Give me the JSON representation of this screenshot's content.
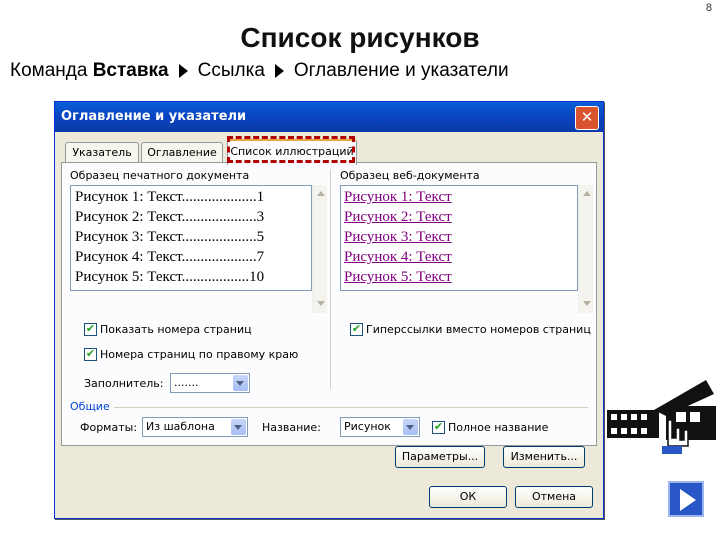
{
  "slide": {
    "number": "8",
    "title": "Список рисунков",
    "command_prefix": "Команда",
    "path": [
      "Вставка",
      "Ссылка",
      "Оглавление и указатели"
    ]
  },
  "dialog": {
    "title": "Оглавление и указатели",
    "close_symbol": "✕",
    "tabs": [
      "Указатель",
      "Оглавление",
      "Список иллюстраций"
    ],
    "print_preview_label": "Образец печатного документа",
    "print_preview_rows": [
      {
        "text": "Рисунок 1: Текст",
        "leader": "....................",
        "page": "1"
      },
      {
        "text": "Рисунок 2: Текст",
        "leader": "....................",
        "page": "3"
      },
      {
        "text": "Рисунок 3: Текст",
        "leader": "....................",
        "page": "5"
      },
      {
        "text": "Рисунок 4: Текст",
        "leader": "....................",
        "page": "7"
      },
      {
        "text": "Рисунок 5: Текст",
        "leader": "..................",
        "page": "10"
      }
    ],
    "web_preview_label": "Образец веб-документа",
    "web_preview_rows": [
      "Рисунок 1: Текст",
      "Рисунок 2: Текст",
      "Рисунок 3: Текст",
      "Рисунок 4: Текст",
      "Рисунок 5: Текст"
    ],
    "show_page_numbers": {
      "label": "Показать номера страниц",
      "checked": true
    },
    "right_align": {
      "label": "Номера страниц по правому краю",
      "checked": true
    },
    "hyperlinks": {
      "label": "Гиперссылки вместо номеров страниц",
      "checked": true
    },
    "filler_label": "Заполнитель:",
    "filler_value": ".......",
    "general_label": "Общие",
    "formats_label": "Форматы:",
    "formats_value": "Из шаблона",
    "caption_label": "Название:",
    "caption_value": "Рисунок",
    "full_caption": {
      "label": "Полное название",
      "checked": true
    },
    "options_button": "Параметры...",
    "modify_button": "Изменить...",
    "ok_button": "ОК",
    "cancel_button": "Отмена"
  },
  "colors": {
    "accent_blue": "#0846c4",
    "highlight_red": "#b00000",
    "link_purple": "#800080"
  },
  "icons": [
    "next-slide-arrow-icon",
    "clip-art-hand-film-icon"
  ]
}
